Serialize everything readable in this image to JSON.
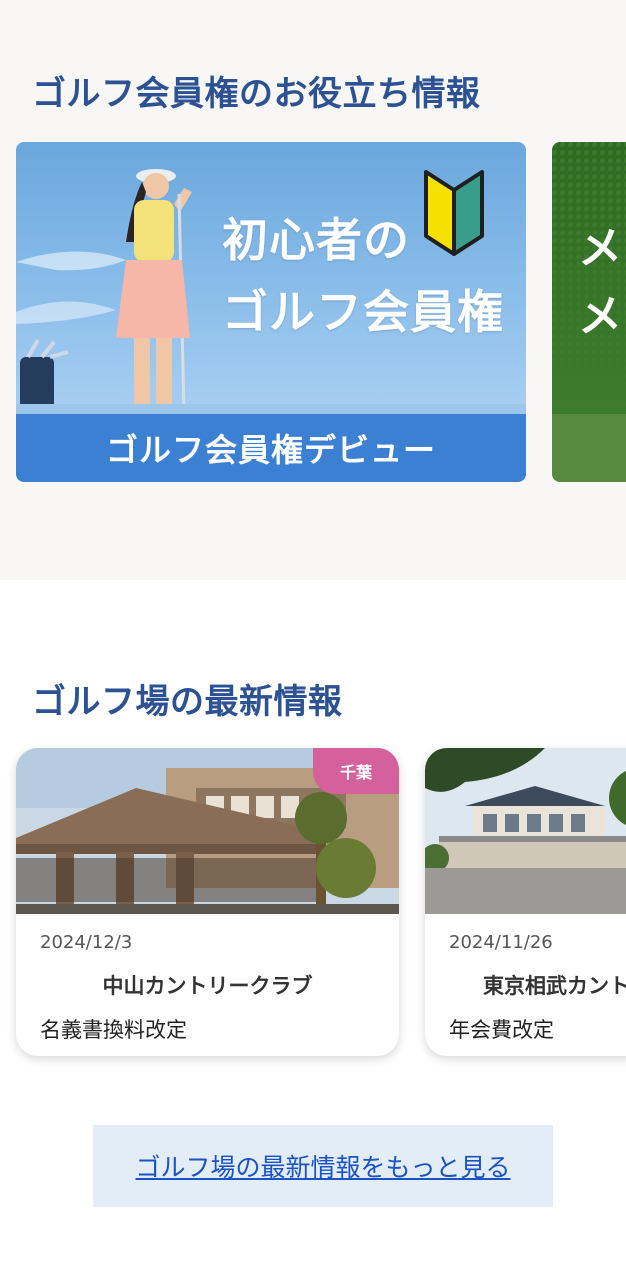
{
  "tips_section": {
    "title": "ゴルフ会員権のお役立ち情報",
    "cards": [
      {
        "image_text_line1": "初心者の",
        "image_text_line2": "ゴルフ会員権",
        "caption": "ゴルフ会員権デビュー",
        "image_icon": "beginner-mark-icon",
        "colors": {
          "sky": "#84b9e8",
          "caption_bar": "#3b80d3"
        }
      },
      {
        "image_text_line1": "メ",
        "image_text_line2": "メ",
        "colors": {
          "grass": "#3c7d2c",
          "caption_bar": "#57893e"
        }
      }
    ]
  },
  "news_section": {
    "title": "ゴルフ場の最新情報",
    "cards": [
      {
        "badge": "千葉",
        "date": "2024/12/3",
        "club_name": "中山カントリークラブ",
        "subject": "名義書換料改定"
      },
      {
        "date": "2024/11/26",
        "club_name": "東京相武カント",
        "subject": "年会費改定"
      }
    ],
    "more_link": "ゴルフ場の最新情報をもっと見る"
  },
  "colors": {
    "heading": "#2c5294",
    "badge": "#d4619c",
    "link": "#1b52c5",
    "link_bg": "#e3edf8",
    "section_bg": "#f9f7f6"
  }
}
